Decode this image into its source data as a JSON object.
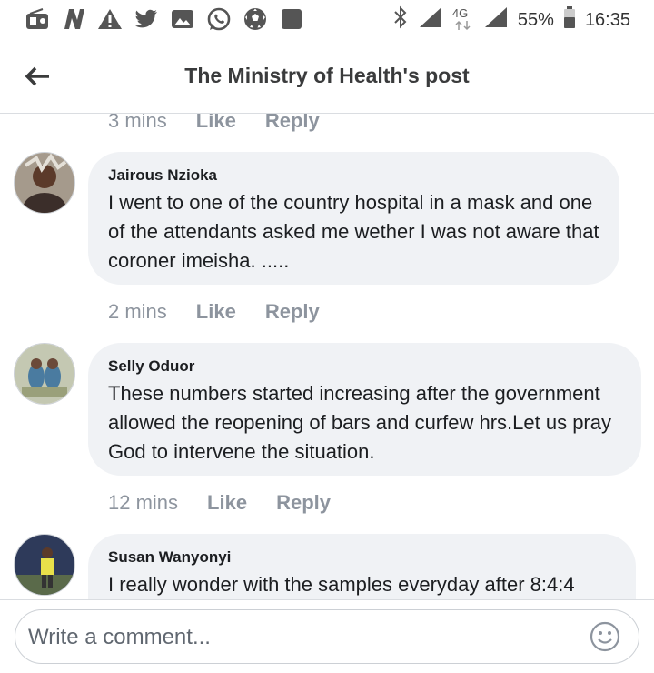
{
  "status_bar": {
    "left_icons": [
      "radio-icon",
      "n-app-icon",
      "warning-icon",
      "twitter-icon",
      "gallery-icon",
      "whatsapp-icon",
      "soccer-ball-icon",
      "square-app-icon"
    ],
    "network": "4G",
    "battery": "55%",
    "time": "16:35"
  },
  "header": {
    "title": "The Ministry of Health's post"
  },
  "comments": [
    {
      "time": "3 mins",
      "like": "Like",
      "reply": "Reply"
    },
    {
      "author": "Jairous Nzioka",
      "text": "I went to one of the country hospital in a mask and one of the attendants asked me wether I was not aware that coroner imeisha. .....",
      "time": "2 mins",
      "like": "Like",
      "reply": "Reply"
    },
    {
      "author": "Selly Oduor",
      "text": "These numbers started increasing after the government allowed the reopening of bars and curfew hrs.Let us pray God to intervene the situation.",
      "time": "12 mins",
      "like": "Like",
      "reply": "Reply"
    },
    {
      "author": "Susan Wanyonyi",
      "text": "I really wonder with the samples everyday after 8:4:4"
    }
  ],
  "composer": {
    "placeholder": "Write a comment..."
  }
}
